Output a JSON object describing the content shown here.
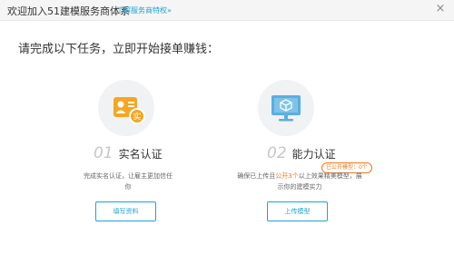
{
  "header": {
    "title": "欢迎加入51建模服务商体系",
    "link_label": "了解服务商特权»",
    "close_label": "×"
  },
  "instruction": "请完成以下任务，立即开始接单赚钱：",
  "tasks": [
    {
      "number": "01",
      "title": "实名认证",
      "description": "完成实名认证，让雇主更加信任你",
      "button_label": "填写资料",
      "icon": "id-card-icon",
      "icon_color": "#f5a623"
    },
    {
      "number": "02",
      "title": "能力认证",
      "description_prefix": "确保已上传且",
      "description_highlight": "公开3个",
      "description_suffix": "以上效果精美模型，展示你的建模实力",
      "badge": "已公开模型：0个",
      "button_label": "上传模型",
      "icon": "monitor-cube-icon",
      "icon_color": "#5aaee0"
    }
  ],
  "colors": {
    "accent": "#1aa3d6",
    "highlight": "#f0771b"
  }
}
